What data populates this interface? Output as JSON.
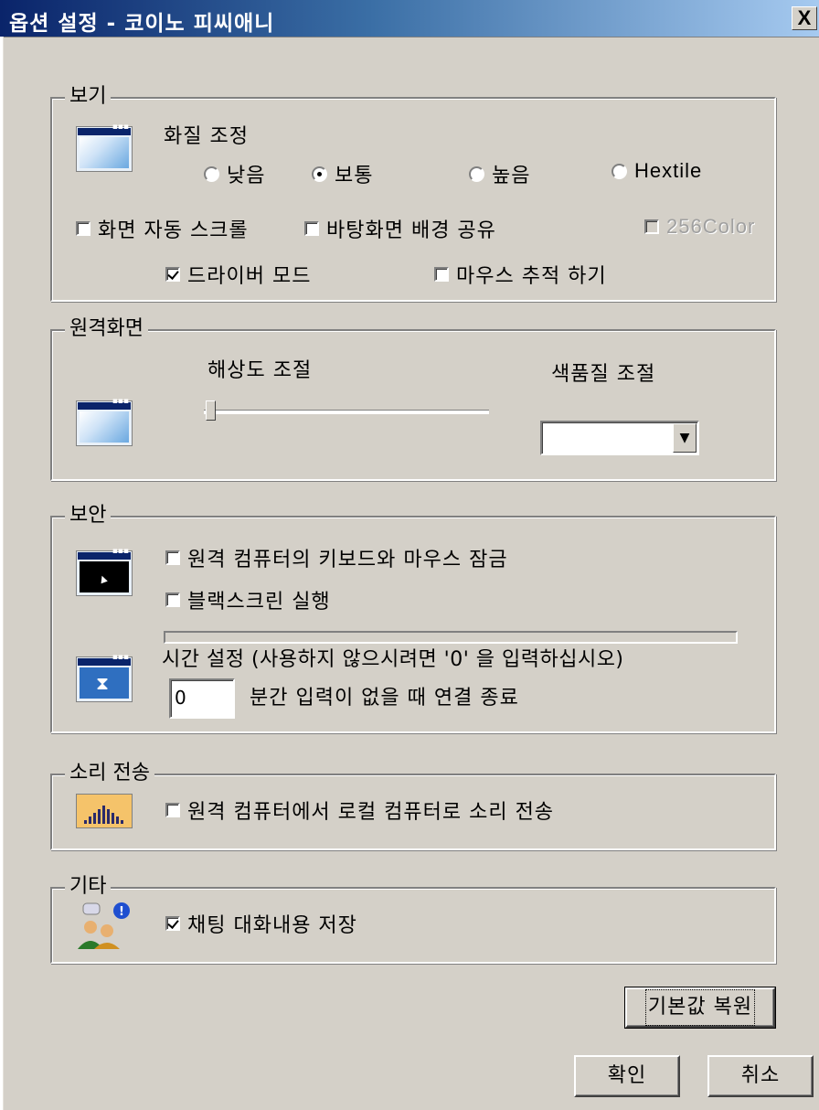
{
  "window": {
    "title": "옵션 설정 - 코이노 피씨애니",
    "close": "X"
  },
  "view": {
    "legend": "보기",
    "quality_label": "화질 조정",
    "radios": [
      {
        "label": "낮음",
        "checked": false
      },
      {
        "label": "보통",
        "checked": true
      },
      {
        "label": "높음",
        "checked": false
      },
      {
        "label": "Hextile",
        "checked": false
      }
    ],
    "auto_scroll": {
      "label": "화면 자동 스크롤",
      "checked": false
    },
    "wallpaper_share": {
      "label": "바탕화면 배경 공유",
      "checked": false
    },
    "color256": {
      "label": "256Color",
      "checked": false,
      "disabled": true
    },
    "driver_mode": {
      "label": "드라이버 모드",
      "checked": true
    },
    "mouse_track": {
      "label": "마우스 추적 하기",
      "checked": false
    }
  },
  "remote": {
    "legend": "원격화면",
    "resolution_label": "해상도 조절",
    "resolution_slider_value": 0,
    "color_label": "색품질 조절",
    "color_value": ""
  },
  "security": {
    "legend": "보안",
    "lock_input": {
      "label": "원격 컴퓨터의 키보드와 마우스 잠금",
      "checked": false
    },
    "blackscreen": {
      "label": "블랙스크린 실행",
      "checked": false
    },
    "time_label": "시간 설정 (사용하지 않으시려면 '0' 을 입력하십시오)",
    "time_value": "0",
    "time_suffix": "분간 입력이 없을 때 연결 종료"
  },
  "sound": {
    "legend": "소리 전송",
    "transfer": {
      "label": "원격 컴퓨터에서 로컬 컴퓨터로 소리 전송",
      "checked": false
    }
  },
  "other": {
    "legend": "기타",
    "save_chat": {
      "label": "채팅 대화내용 저장",
      "checked": true
    }
  },
  "buttons": {
    "restore": "기본값 복원",
    "ok": "확인",
    "cancel": "취소"
  },
  "colors": {
    "title_start": "#0a246a",
    "title_end": "#a6caf0",
    "face": "#d4d0c8"
  }
}
